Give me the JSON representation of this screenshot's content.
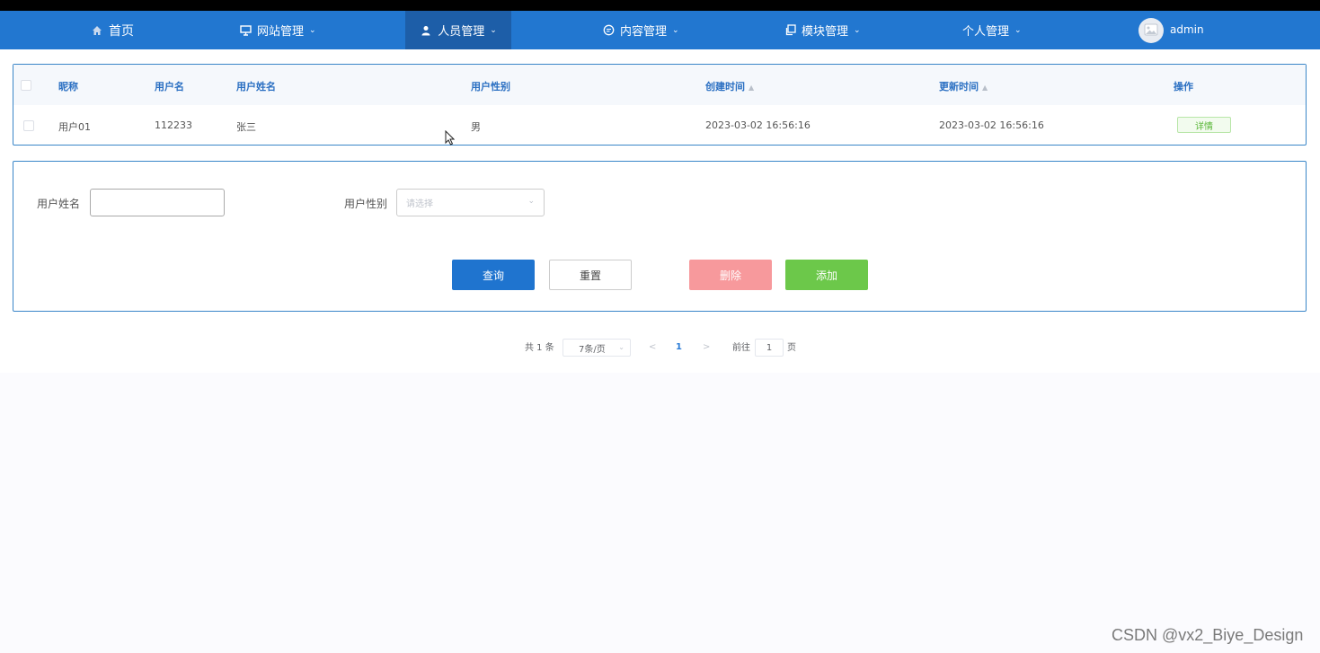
{
  "nav": {
    "items": [
      {
        "label": "首页",
        "icon": "home-icon",
        "has_caret": false
      },
      {
        "label": "网站管理",
        "icon": "monitor-icon",
        "has_caret": true
      },
      {
        "label": "人员管理",
        "icon": "user-icon",
        "has_caret": true,
        "active": true
      },
      {
        "label": "内容管理",
        "icon": "chat-icon",
        "has_caret": true
      },
      {
        "label": "模块管理",
        "icon": "copy-icon",
        "has_caret": true
      },
      {
        "label": "个人管理",
        "icon": null,
        "has_caret": true
      }
    ],
    "user": {
      "name": "admin",
      "avatar_icon": "image-icon"
    }
  },
  "table": {
    "headers": [
      "昵称",
      "用户名",
      "用户姓名",
      "用户性别",
      "创建时间",
      "更新时间",
      "操作"
    ],
    "rows": [
      {
        "nickname": "用户01",
        "username": "112233",
        "realname": "张三",
        "gender": "男",
        "created": "2023-03-02 16:56:16",
        "updated": "2023-03-02 16:56:16",
        "action": "详情"
      }
    ]
  },
  "search": {
    "name_label": "用户姓名",
    "name_value": "",
    "gender_label": "用户性别",
    "gender_placeholder": "请选择",
    "buttons": {
      "query": "查询",
      "reset": "重置",
      "delete": "删除",
      "add": "添加"
    }
  },
  "pagination": {
    "total_text": "共 1 条",
    "page_size": "7条/页",
    "current_page": "1",
    "goto_label": "前往",
    "goto_value": "1",
    "page_suffix": "页"
  },
  "watermark": "CSDN @vx2_Biye_Design",
  "colors": {
    "navbar": "#2277d0",
    "nav_active": "#1d5ea8",
    "header_text": "#2a6fc2",
    "query": "#1f74cf",
    "delete": "#f7999c",
    "add": "#6cc84a"
  }
}
